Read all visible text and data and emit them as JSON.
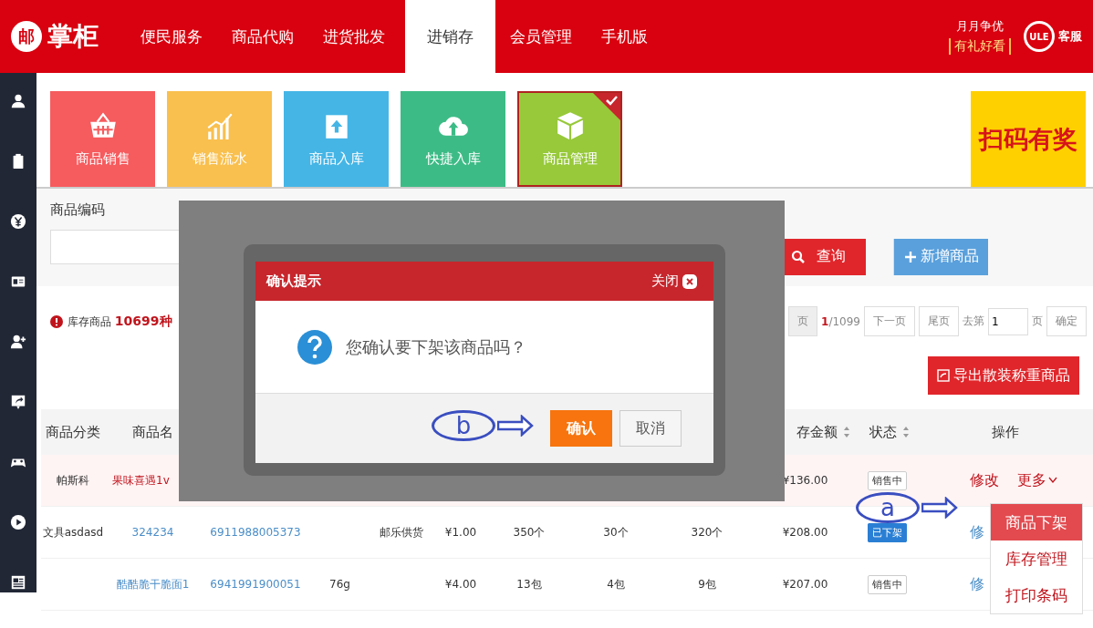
{
  "top_nav": {
    "logo": {
      "mark": "邮",
      "text": "掌柜"
    },
    "tabs": [
      {
        "label": "便民服务",
        "selected": false
      },
      {
        "label": "商品代购",
        "selected": false
      },
      {
        "label": "进货批发",
        "selected": false
      },
      {
        "label": "进销存",
        "selected": true
      },
      {
        "label": "会员管理",
        "selected": false
      },
      {
        "label": "手机版",
        "selected": false
      }
    ],
    "promo": {
      "line_1": "月月争优",
      "line_2": "有礼好看"
    },
    "service": {
      "badge": "ULE",
      "label": "客服"
    }
  },
  "sidebar": {
    "items": [
      {
        "kind": "user"
      },
      {
        "kind": "clipboard"
      },
      {
        "kind": "yen"
      },
      {
        "kind": "card"
      },
      {
        "kind": "add-user"
      },
      {
        "kind": "share"
      },
      {
        "kind": "gamepad"
      },
      {
        "kind": "play"
      },
      {
        "kind": "news"
      }
    ]
  },
  "quick_tiles": [
    {
      "label": "商品销售",
      "color": "#f65b5e",
      "kind": "basket",
      "selected": false
    },
    {
      "label": "销售流水",
      "color": "#f9c04f",
      "kind": "chart",
      "selected": false
    },
    {
      "label": "商品入库",
      "color": "#45b5e6",
      "kind": "box-in",
      "selected": false
    },
    {
      "label": "快捷入库",
      "color": "#3dbb86",
      "kind": "cloud",
      "selected": false
    },
    {
      "label": "商品管理",
      "color": "#97c93a",
      "kind": "cube",
      "selected": true
    }
  ],
  "banner": {
    "text": "扫码有奖"
  },
  "search": {
    "label": "商品编码",
    "search_button": "查询",
    "add_button": "新增商品"
  },
  "summary": {
    "stock_text": "库存商品 **10699种**"
  },
  "pagination": {
    "prev_partial": "页",
    "current": "1",
    "total": "/1099",
    "next": "下一页",
    "last": "尾页",
    "goto_label": "去第",
    "goto_value": "1",
    "page_suffix": "页",
    "confirm": "确定"
  },
  "export_button": "导出散装称重商品",
  "table": {
    "columns": [
      {
        "label": "商品分类",
        "sortable": false
      },
      {
        "label": "商品名",
        "sortable": false
      },
      {
        "label": "存金额",
        "sortable": true
      },
      {
        "label": "状态",
        "sortable": true
      },
      {
        "label": "操作",
        "sortable": false
      }
    ],
    "rows": [
      {
        "selected": true,
        "category": "帕斯科",
        "name": "果味喜遇1v",
        "amount": "¥136.00",
        "status": {
          "label": "销售中",
          "kind": "on_sale"
        },
        "actions": [
          {
            "label": "修改",
            "kind": "edit"
          },
          {
            "label": "更多",
            "kind": "more"
          }
        ]
      },
      {
        "selected": false,
        "category": "文具asdasd",
        "name": "324234",
        "barcode": "6911988005373",
        "supplier": "邮乐供货",
        "price": "¥1.00",
        "qty_1": "350个",
        "qty_2": "30个",
        "qty_3": "320个",
        "amount": "¥208.00",
        "status": {
          "label": "已下架",
          "kind": "off_shelf"
        },
        "actions": [
          {
            "label": "修",
            "kind": "edit"
          }
        ]
      },
      {
        "selected": false,
        "name": "酷酷脆干脆面1",
        "barcode": "6941991900051",
        "spec": "76g",
        "price": "¥4.00",
        "qty_1": "13包",
        "qty_2": "4包",
        "qty_3": "9包",
        "amount": "¥207.00",
        "status": {
          "label": "销售中",
          "kind": "on_sale"
        },
        "actions": [
          {
            "label": "修",
            "kind": "edit"
          }
        ]
      }
    ]
  },
  "dropdown": {
    "items": [
      {
        "label": "商品下架",
        "selected": true
      },
      {
        "label": "库存管理",
        "selected": false
      },
      {
        "label": "打印条码",
        "selected": false
      }
    ]
  },
  "dialog": {
    "title": "确认提示",
    "close": "关闭",
    "message": "您确认要下架该商品吗？",
    "confirm": "确认",
    "cancel": "取消"
  },
  "annotations": [
    {
      "label": "a"
    },
    {
      "label": "b"
    }
  ]
}
